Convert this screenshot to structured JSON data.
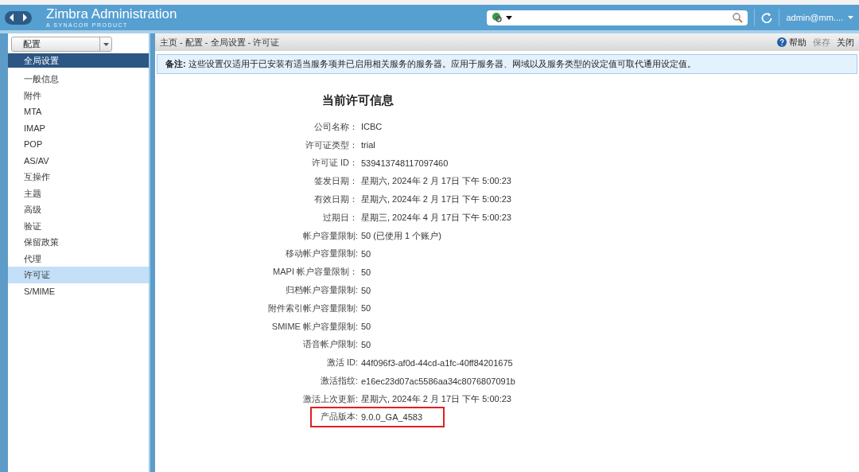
{
  "header": {
    "title": "Zimbra Administration",
    "subtitle": "A SYNACOR PRODUCT",
    "user": "admin@mm...."
  },
  "sidebar": {
    "dropdown": "配置",
    "items": [
      {
        "label": "全局设置",
        "selected": false,
        "kind": "header"
      },
      {
        "label": "一般信息",
        "selected": false,
        "kind": "item"
      },
      {
        "label": "附件",
        "selected": false,
        "kind": "item"
      },
      {
        "label": "MTA",
        "selected": false,
        "kind": "item"
      },
      {
        "label": "IMAP",
        "selected": false,
        "kind": "item"
      },
      {
        "label": "POP",
        "selected": false,
        "kind": "item"
      },
      {
        "label": "AS/AV",
        "selected": false,
        "kind": "item"
      },
      {
        "label": "互操作",
        "selected": false,
        "kind": "item"
      },
      {
        "label": "主题",
        "selected": false,
        "kind": "item"
      },
      {
        "label": "高级",
        "selected": false,
        "kind": "item"
      },
      {
        "label": "验证",
        "selected": false,
        "kind": "item"
      },
      {
        "label": "保留政策",
        "selected": false,
        "kind": "item"
      },
      {
        "label": "代理",
        "selected": false,
        "kind": "item"
      },
      {
        "label": "许可证",
        "selected": true,
        "kind": "item"
      },
      {
        "label": "S/MIME",
        "selected": false,
        "kind": "item"
      }
    ]
  },
  "toolbar": {
    "breadcrumb": "主页 - 配置 - 全局设置 - 许可证",
    "actions": [
      {
        "label": "帮助",
        "disabled": false,
        "kind": "help"
      },
      {
        "label": "保存",
        "disabled": true,
        "kind": "plain"
      },
      {
        "label": "关闭",
        "disabled": false,
        "kind": "plain"
      }
    ]
  },
  "note": "**备注:** 这些设置仅适用于已安装有适当服务项并已启用相关服务的服务器。应用于服务器、网域以及服务类型的设定值可取代通用设定值。",
  "license": {
    "title": "当前许可信息",
    "rows": [
      {
        "label": "公司名称：",
        "value": "ICBC",
        "highlighted": false
      },
      {
        "label": "许可证类型：",
        "value": "trial",
        "highlighted": false
      },
      {
        "label": "许可证 ID：",
        "value": "539413748117097460",
        "highlighted": false
      },
      {
        "label": "签发日期：",
        "value": "星期六, 2024年 2 月 17日 下午 5:00:23",
        "highlighted": false
      },
      {
        "label": "有效日期：",
        "value": "星期六, 2024年 2 月 17日 下午 5:00:23",
        "highlighted": false
      },
      {
        "label": "过期日：",
        "value": "星期三, 2024年 4 月 17日 下午 5:00:23",
        "highlighted": false
      },
      {
        "label": "帐户容量限制:",
        "value": "50 (已使用 1 个账户)",
        "highlighted": false
      },
      {
        "label": "移动帐户容量限制:",
        "value": "50",
        "highlighted": false
      },
      {
        "label": "MAPI 帐户容量限制：",
        "value": "50",
        "highlighted": false
      },
      {
        "label": "归档帐户容量限制:",
        "value": "50",
        "highlighted": false
      },
      {
        "label": "附件索引帐户容量限制:",
        "value": "50",
        "highlighted": false
      },
      {
        "label": "SMIME 帐户容量限制:",
        "value": "50",
        "highlighted": false
      },
      {
        "label": "语音帐户限制:",
        "value": "50",
        "highlighted": false
      },
      {
        "label": "激活 ID:",
        "value": "44f096f3-af0d-44cd-a1fc-40ff84201675",
        "highlighted": false
      },
      {
        "label": "激活指纹:",
        "value": "e16ec23d07ac5586aa34c8076807091b",
        "highlighted": false
      },
      {
        "label": "激活上次更新:",
        "value": "星期六, 2024年 2 月 17日 下午 5:00:23",
        "highlighted": false
      },
      {
        "label": "产品版本:",
        "value": "9.0.0_GA_4583",
        "highlighted": true
      }
    ]
  }
}
